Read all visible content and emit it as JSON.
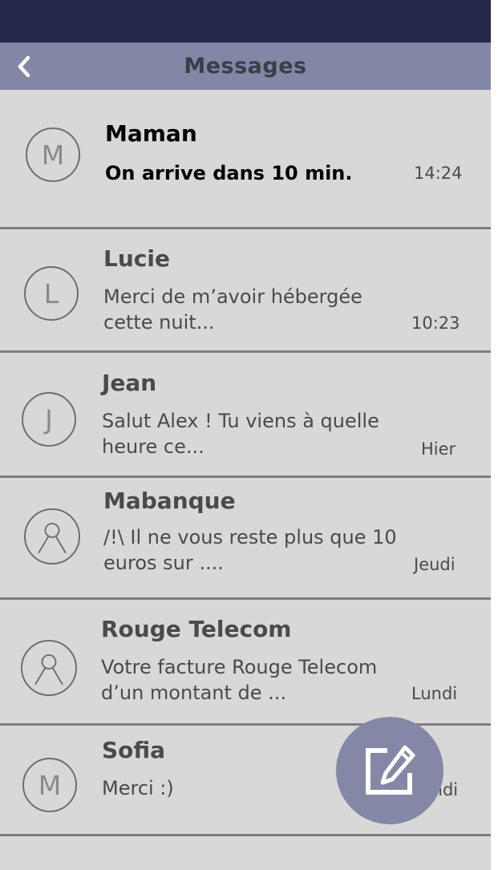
{
  "header": {
    "title": "Messages"
  },
  "conversations": [
    {
      "initial": "M",
      "name": "Maman",
      "preview": "On arrive dans 10 min.",
      "time": "14:24",
      "unread": true,
      "avatar": "letter"
    },
    {
      "initial": "L",
      "name": "Lucie",
      "preview": "Merci de m’avoir hébergée cette nuit...",
      "time": "10:23",
      "unread": false,
      "avatar": "letter"
    },
    {
      "initial": "J",
      "name": "Jean",
      "preview": "Salut Alex ! Tu viens à quelle heure ce...",
      "time": "Hier",
      "unread": false,
      "avatar": "letter"
    },
    {
      "initial": "",
      "name": "Mabanque",
      "preview": "/!\\ Il ne vous reste plus que 10 euros sur ....",
      "time": "Jeudi",
      "unread": false,
      "avatar": "person-icon"
    },
    {
      "initial": "",
      "name": "Rouge Telecom",
      "preview": "Votre facture Rouge Telecom d’un montant de ...",
      "time": "Lundi",
      "unread": false,
      "avatar": "person-icon"
    },
    {
      "initial": "M",
      "name": "Sofia",
      "preview": "Merci :)",
      "time": "Lundi",
      "unread": false,
      "avatar": "letter"
    }
  ],
  "icons": {
    "back": "chevron-left-icon",
    "compose": "compose-icon",
    "contact": "person-icon"
  },
  "colors": {
    "status_bar": "#24284a",
    "header": "#8287a5",
    "list_background": "#d8d8d8",
    "fab": "#8587a6"
  }
}
